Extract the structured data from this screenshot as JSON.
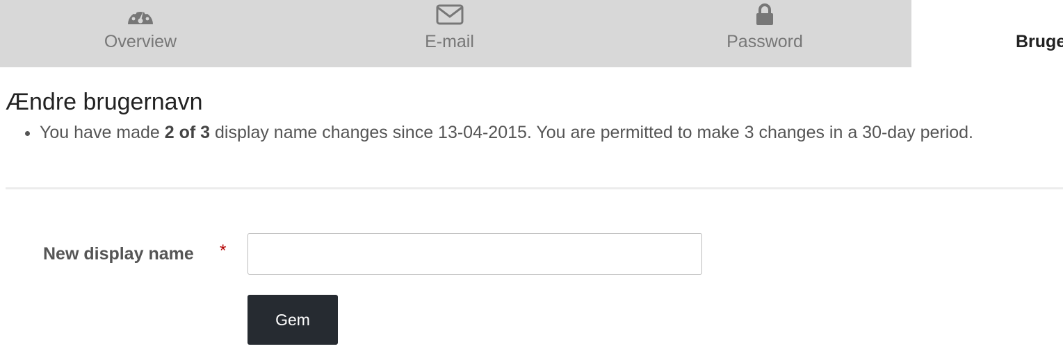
{
  "tabs": [
    {
      "label": "Overview",
      "icon": "dashboard-icon",
      "active": false
    },
    {
      "label": "E-mail",
      "icon": "envelope-icon",
      "active": false
    },
    {
      "label": "Password",
      "icon": "lock-icon",
      "active": false
    },
    {
      "label": "Bruge",
      "icon": "user-icon",
      "active": true
    }
  ],
  "page": {
    "title": "Ændre brugernavn",
    "info": {
      "before": "You have made ",
      "count": "2 of 3",
      "after": " display name changes since 13-04-2015. You are permitted to make 3 changes in a 30-day period."
    }
  },
  "form": {
    "label": "New display name",
    "required_mark": "*",
    "input_value": "",
    "submit_label": "Gem"
  },
  "colors": {
    "tab_bar": "#d8d8d8",
    "active_tab": "#ffffff",
    "button": "#262b31",
    "required": "#b30000"
  }
}
